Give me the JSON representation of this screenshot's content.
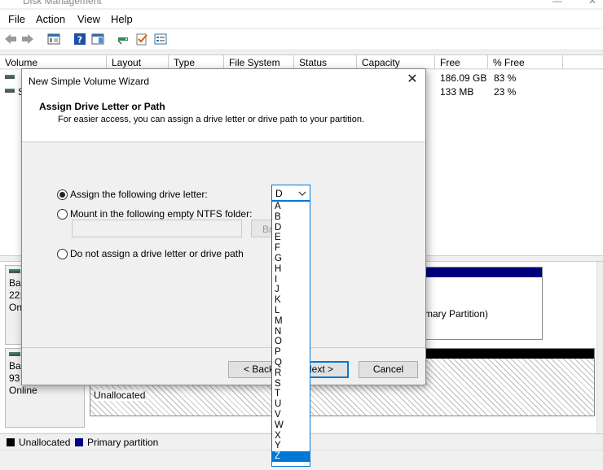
{
  "window": {
    "title": "Disk Management",
    "minimize": "—",
    "close": "✕"
  },
  "menu": [
    "File",
    "Action",
    "View",
    "Help"
  ],
  "toolbar": {
    "icons": [
      "back-icon",
      "forward-icon",
      "console-tree-icon",
      "help-icon",
      "action-pane-icon",
      "connect-disk-icon",
      "checklist-icon",
      "properties-icon"
    ]
  },
  "volume_table": {
    "columns": [
      "Volume",
      "Layout",
      "Type",
      "File System",
      "Status",
      "Capacity",
      "Free Spa...",
      "% Free"
    ],
    "rows": [
      {
        "volume": "",
        "free_space": "186.09 GB",
        "pct_free": "83 %"
      },
      {
        "volume": "S",
        "free_space": "133 MB",
        "pct_free": "23 %"
      }
    ]
  },
  "disks": [
    {
      "label_lines": [
        "Ba",
        "22:",
        "On"
      ],
      "partition_text": "mary Partition)"
    },
    {
      "label_lines": [
        "Ba",
        "93",
        "Online"
      ],
      "partition_text": "Unallocated"
    }
  ],
  "legend": [
    {
      "label": "Unallocated",
      "color": "#000000"
    },
    {
      "label": "Primary partition",
      "color": "#00007f"
    }
  ],
  "wizard": {
    "title": "New Simple Volume Wizard",
    "close": "✕",
    "heading": "Assign Drive Letter or Path",
    "subheading": "For easier access, you can assign a drive letter or drive path to your partition.",
    "options": [
      {
        "label": "Assign the following drive letter:",
        "selected": true
      },
      {
        "label": "Mount in the following empty NTFS folder:",
        "selected": false
      },
      {
        "label": "Do not assign a drive letter or drive path",
        "selected": false
      }
    ],
    "folder_path_value": "",
    "browse_label": "Browse...",
    "back_label": "< Back",
    "next_label": "Next >",
    "cancel_label": "Cancel"
  },
  "drive_letter": {
    "selected": "D",
    "options": [
      "A",
      "B",
      "D",
      "E",
      "F",
      "G",
      "H",
      "I",
      "J",
      "K",
      "L",
      "M",
      "N",
      "O",
      "P",
      "Q",
      "R",
      "S",
      "T",
      "U",
      "V",
      "W",
      "X",
      "Y",
      "Z"
    ],
    "highlighted": "Z"
  },
  "colors": {
    "accent": "#0078d7",
    "primary_partition": "#00007f",
    "unallocated": "#000000"
  }
}
